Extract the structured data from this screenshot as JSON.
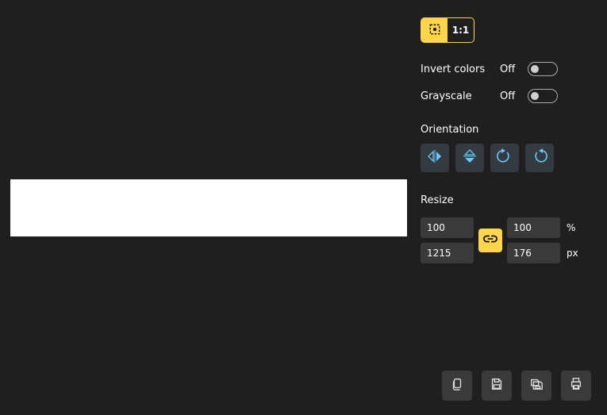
{
  "zoom": {
    "fit_mode": "fit",
    "ratio_label": "1:1"
  },
  "toggles": {
    "invert": {
      "label": "Invert colors",
      "state": "Off"
    },
    "grayscale": {
      "label": "Grayscale",
      "state": "Off"
    }
  },
  "orientation": {
    "label": "Orientation"
  },
  "resize": {
    "label": "Resize",
    "percent_w": "100",
    "percent_h": "100",
    "px_w": "1215",
    "px_h": "176",
    "unit_percent": "%",
    "unit_px": "px"
  },
  "colors": {
    "accent": "#ffd54a"
  }
}
